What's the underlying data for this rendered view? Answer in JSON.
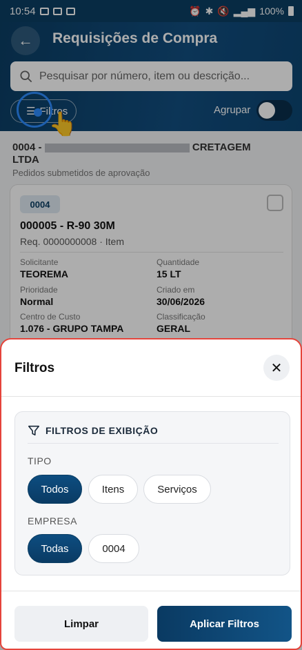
{
  "status": {
    "time": "10:54",
    "battery": "100%"
  },
  "header": {
    "title": "Requisições de Compra",
    "search_placeholder": "Pesquisar por número, item ou descrição...",
    "filter_label": "Filtros",
    "group_label": "Agrupar"
  },
  "list": {
    "company_name_start": "0004 -",
    "company_name_end": "CRETAGEM",
    "company_line2": "LTDA",
    "company_sub": "Pedidos submetidos de aprovação",
    "card": {
      "badge": "0004",
      "title": "000005 - R-90 30M",
      "subtitle": "Req. 0000000008 · Item",
      "fields": [
        {
          "label": "Solicitante",
          "value": "TEOREMA"
        },
        {
          "label": "Quantidade",
          "value": "15 LT"
        },
        {
          "label": "Prioridade",
          "value": "Normal"
        },
        {
          "label": "Criado em",
          "value": "30/06/2026"
        },
        {
          "label": "Centro de Custo",
          "value": "1.076 - GRUPO TAMPA"
        },
        {
          "label": "Classificação",
          "value": "GERAL"
        }
      ]
    }
  },
  "sheet": {
    "title": "Filtros",
    "panel_title": "FILTROS DE EXIBIÇÃO",
    "tipo_label": "TIPO",
    "tipo_options": [
      "Todos",
      "Itens",
      "Serviços"
    ],
    "tipo_selected": "Todos",
    "empresa_label": "EMPRESA",
    "empresa_options": [
      "Todas",
      "0004"
    ],
    "empresa_selected": "Todas",
    "clear_label": "Limpar",
    "apply_label": "Aplicar Filtros"
  }
}
